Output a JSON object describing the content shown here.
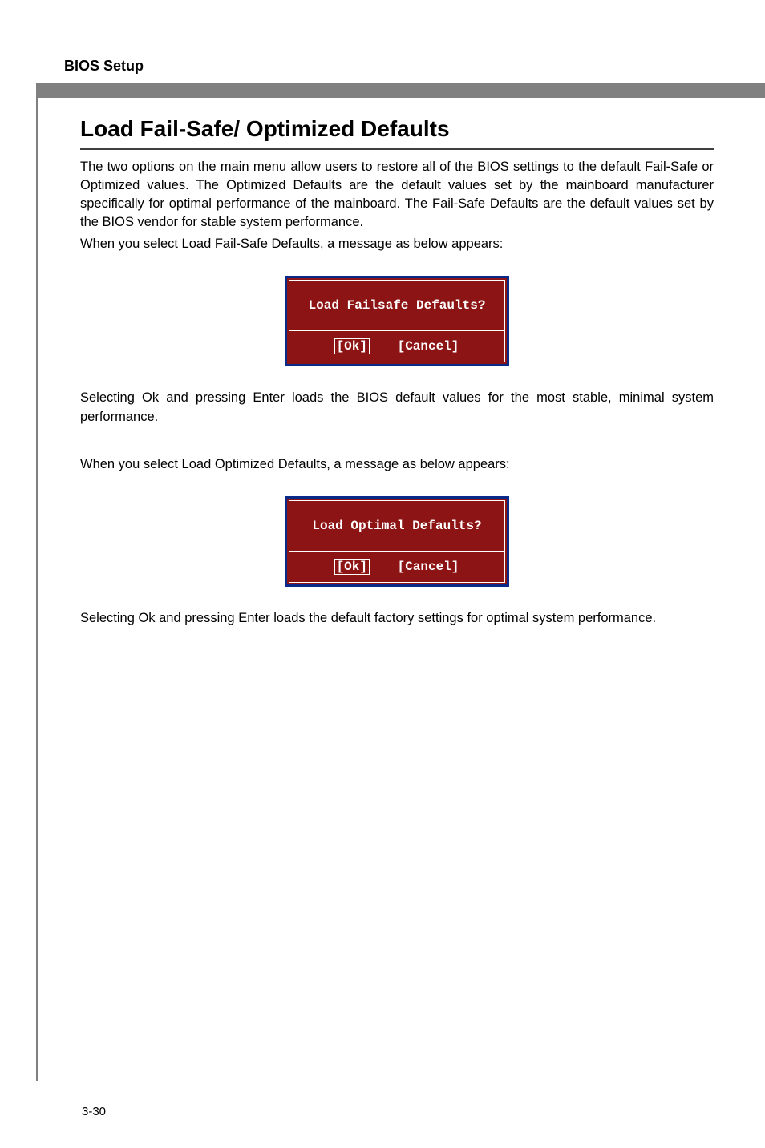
{
  "header": {
    "title": "BIOS Setup"
  },
  "section": {
    "heading": "Load Fail-Safe/ Optimized Defaults",
    "para1": "The two options on the main menu allow users to restore all of the BIOS settings to the default Fail-Safe or Optimized values. The Optimized Defaults are the default values set by the mainboard manufacturer specifically for optimal performance of the mainboard. The Fail-Safe Defaults are the default values set by the BIOS vendor for stable system performance.",
    "para2": "When you select Load Fail-Safe Defaults, a message as below appears:",
    "para3": "Selecting Ok and pressing Enter loads the BIOS default values for the most stable, minimal system performance.",
    "para4": "When you select Load Optimized Defaults, a message as below appears:",
    "para5": "Selecting Ok and pressing Enter loads the default factory settings for optimal system performance."
  },
  "dialog1": {
    "question": "Load Failsafe Defaults?",
    "ok": "[Ok]",
    "cancel": "[Cancel]"
  },
  "dialog2": {
    "question": "Load Optimal Defaults?",
    "ok": "[Ok]",
    "cancel": "[Cancel]"
  },
  "footer": {
    "page_number": "3-30"
  }
}
